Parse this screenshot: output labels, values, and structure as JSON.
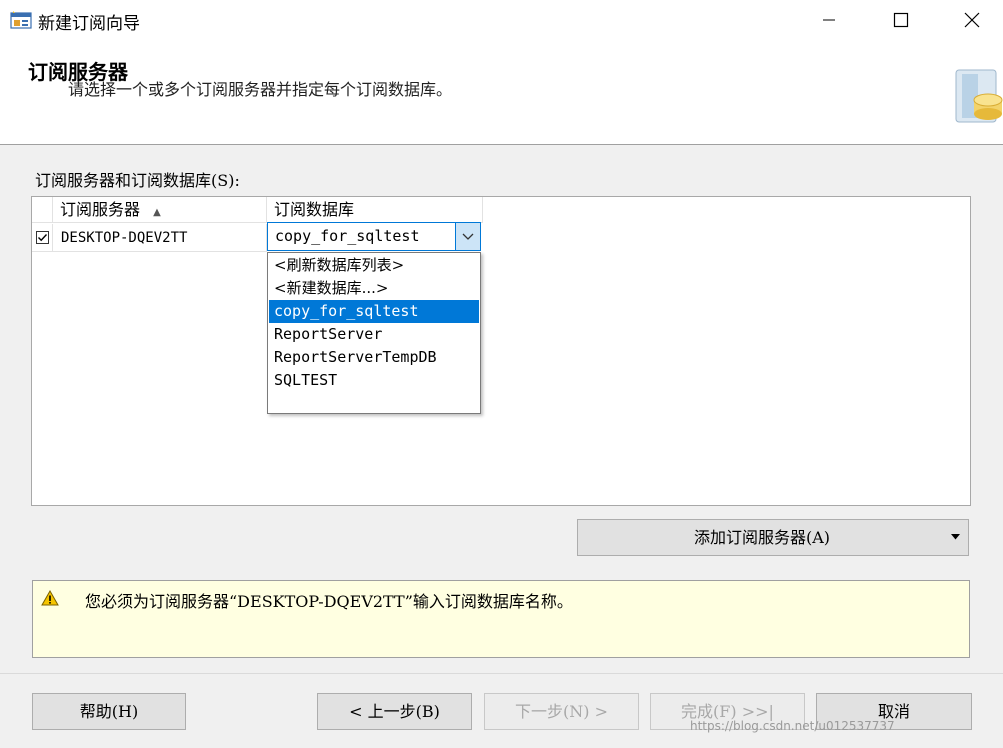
{
  "window": {
    "title": "新建订阅向导"
  },
  "header": {
    "title": "订阅服务器",
    "subtitle": "请选择一个或多个订阅服务器并指定每个订阅数据库。"
  },
  "grid": {
    "label": "订阅服务器和订阅数据库(S):",
    "columns": [
      "订阅服务器",
      "订阅数据库"
    ],
    "sort_indicator": "▲",
    "rows": [
      {
        "checked": true,
        "subscriber": "DESKTOP-DQEV2TT",
        "database": "copy_for_sqltest"
      }
    ]
  },
  "dropdown": {
    "options": [
      "<刷新数据库列表>",
      "<新建数据库...>",
      "copy_for_sqltest",
      "ReportServer",
      "ReportServerTempDB",
      "SQLTEST"
    ],
    "selected_index": 2
  },
  "add_subscriber_button": {
    "label": "添加订阅服务器(A)"
  },
  "message": {
    "text": "您必须为订阅服务器“DESKTOP-DQEV2TT”输入订阅数据库名称。"
  },
  "footer": {
    "help_label": "帮助(H)",
    "back_label": "< 上一步(B)",
    "next_label": "下一步(N) >",
    "finish_label": "完成(F) >>|",
    "cancel_label": "取消"
  },
  "watermark": "https://blog.csdn.net/u012537737",
  "colors": {
    "accent": "#0078d7",
    "message_background": "#ffffe1",
    "warning": "#f5c400"
  },
  "icons": {
    "app": "wizard-window-icon",
    "minimize": "minimize-icon",
    "maximize": "maximize-icon",
    "close": "close-icon",
    "header": "database-server-icon",
    "sort": "sort-ascending-icon",
    "checkbox": "checkbox-checked-icon",
    "combo": "chevron-down-icon",
    "warning": "warning-icon"
  }
}
